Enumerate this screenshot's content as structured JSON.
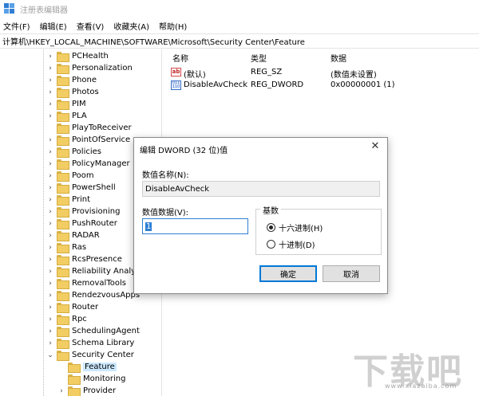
{
  "window": {
    "title": "注册表编辑器"
  },
  "menu": [
    "文件(F)",
    "编辑(E)",
    "查看(V)",
    "收藏夹(A)",
    "帮助(H)"
  ],
  "address": "计算机\\HKEY_LOCAL_MACHINE\\SOFTWARE\\Microsoft\\Security Center\\Feature",
  "tree": {
    "items": [
      {
        "label": "PCHealth",
        "expander": "›"
      },
      {
        "label": "Personalization",
        "expander": "›"
      },
      {
        "label": "Phone",
        "expander": "›"
      },
      {
        "label": "Photos",
        "expander": "›"
      },
      {
        "label": "PIM",
        "expander": "›"
      },
      {
        "label": "PLA",
        "expander": "›"
      },
      {
        "label": "PlayToReceiver",
        "expander": ""
      },
      {
        "label": "PointOfService",
        "expander": "›"
      },
      {
        "label": "Policies",
        "expander": "›"
      },
      {
        "label": "PolicyManager",
        "expander": "›"
      },
      {
        "label": "Poom",
        "expander": "›"
      },
      {
        "label": "PowerShell",
        "expander": "›"
      },
      {
        "label": "Print",
        "expander": "›"
      },
      {
        "label": "Provisioning",
        "expander": "›"
      },
      {
        "label": "PushRouter",
        "expander": "›"
      },
      {
        "label": "RADAR",
        "expander": "›"
      },
      {
        "label": "Ras",
        "expander": "›"
      },
      {
        "label": "RcsPresence",
        "expander": "›"
      },
      {
        "label": "Reliability Analysis",
        "expander": "›"
      },
      {
        "label": "RemovalTools",
        "expander": "›"
      },
      {
        "label": "RendezvousApps",
        "expander": "›"
      },
      {
        "label": "Router",
        "expander": "›"
      },
      {
        "label": "Rpc",
        "expander": "›"
      },
      {
        "label": "SchedulingAgent",
        "expander": "›"
      },
      {
        "label": "Schema Library",
        "expander": "›"
      },
      {
        "label": "Security Center",
        "expander": "⌄"
      },
      {
        "label": "Feature",
        "expander": "",
        "child": true,
        "selected": true
      },
      {
        "label": "Monitoring",
        "expander": "",
        "child": true
      },
      {
        "label": "Provider",
        "expander": "›",
        "child": true
      }
    ]
  },
  "list": {
    "headers": {
      "name": "名称",
      "type": "类型",
      "data": "数据"
    },
    "rows": [
      {
        "icon": "string-value-icon",
        "icon_text": "ab",
        "name": "(默认)",
        "type": "REG_SZ",
        "data": "(数值未设置)"
      },
      {
        "icon": "dword-value-icon",
        "icon_text": "011\n110",
        "name": "DisableAvCheck",
        "type": "REG_DWORD",
        "data": "0x00000001 (1)"
      }
    ]
  },
  "dialog": {
    "title": "编辑 DWORD (32 位)值",
    "name_label": "数值名称(N):",
    "name_value": "DisableAvCheck",
    "data_label": "数值数据(V):",
    "data_value": "1",
    "base_label": "基数",
    "radio_hex": "十六进制(H)",
    "radio_dec": "十进制(D)",
    "ok": "确定",
    "cancel": "取消",
    "close": "✕"
  },
  "watermark": {
    "text": "下载吧",
    "url": "www.xiazaiba.com"
  },
  "colors": {
    "selection": "#cce8ff",
    "accent": "#0078d7"
  }
}
